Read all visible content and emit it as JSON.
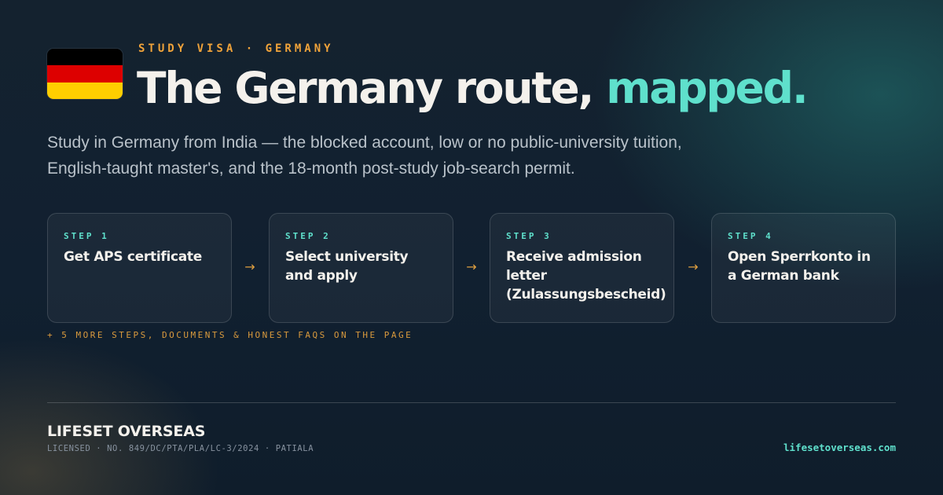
{
  "flag": {
    "name": "germany-flag-icon",
    "colors": [
      "#000000",
      "#dd0000",
      "#ffce00"
    ]
  },
  "header": {
    "eyebrow": "STUDY VISA · GERMANY",
    "headline_main": "The Germany route, ",
    "headline_accent": "mapped."
  },
  "subtitle": "Study in Germany from India — the blocked account, low or no public-university tuition, English-taught master's, and the 18-month post-study job-search permit.",
  "steps": [
    {
      "label": "STEP 1",
      "title": "Get APS certificate"
    },
    {
      "label": "STEP 2",
      "title": "Select university and apply"
    },
    {
      "label": "STEP 3",
      "title": "Receive admission letter (Zulassungsbescheid)"
    },
    {
      "label": "STEP 4",
      "title": "Open Sperrkonto in a German bank"
    }
  ],
  "arrow_glyph": "→",
  "more_note": "+ 5 MORE STEPS, DOCUMENTS & HONEST FAQS ON THE PAGE",
  "footer": {
    "brand": "LIFESET OVERSEAS",
    "license": "LICENSED · NO. 849/DC/PTA/PLA/LC-3/2024 · PATIALA",
    "website": "lifesetoverseas.com"
  },
  "colors": {
    "accent": "#5fe0cc",
    "eyebrow": "#f0a33a",
    "background": "#13212e"
  }
}
